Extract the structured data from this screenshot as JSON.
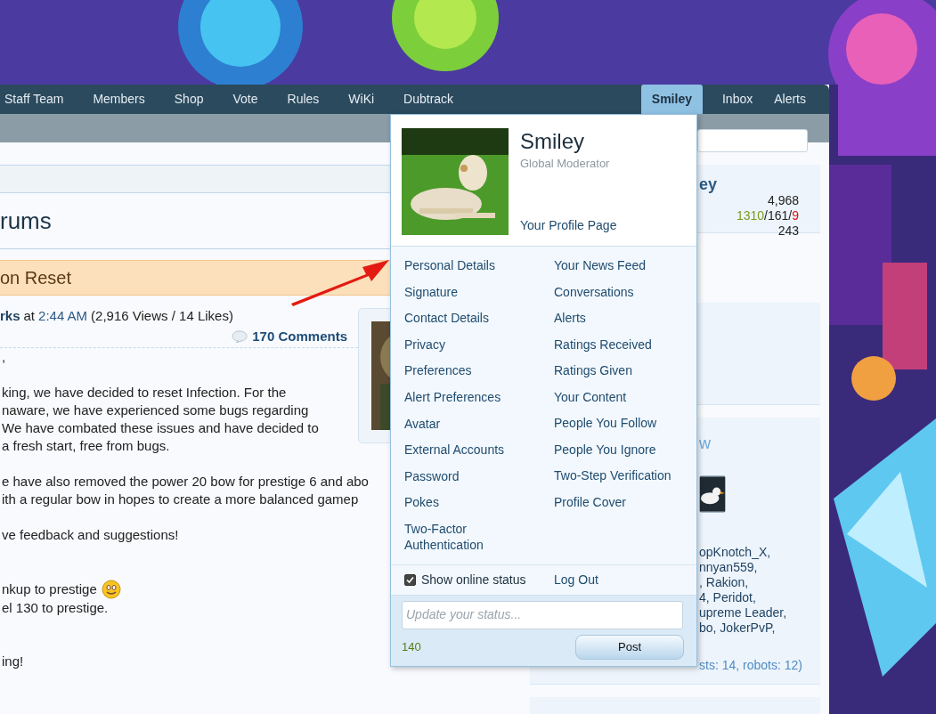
{
  "nav": {
    "tabs": [
      {
        "label": "Staff Team",
        "selected": false
      },
      {
        "label": "Members",
        "selected": false
      },
      {
        "label": "Shop",
        "selected": false
      },
      {
        "label": "Vote",
        "selected": false
      },
      {
        "label": "Rules",
        "selected": false
      },
      {
        "label": "WiKi",
        "selected": false
      },
      {
        "label": "Dubtrack",
        "selected": false
      }
    ],
    "user_tabs": [
      {
        "label": "Smiley",
        "selected": true
      },
      {
        "label": "Inbox",
        "selected": false
      },
      {
        "label": "Alerts",
        "selected": false
      }
    ]
  },
  "page_title": "rums",
  "thread_title": "on Reset",
  "byline": {
    "author": "rks",
    "at": "at",
    "time": "2:44 AM",
    "stats": "(2,916 Views / 14 Likes)"
  },
  "comments": "170 Comments",
  "post_paragraphs": [
    [
      {
        "text": ",",
        "emoji": false
      }
    ],
    [
      {
        "text": "king, we have decided to reset Infection. For the",
        "emoji": false
      },
      {
        "text": "naware, we have experienced some bugs regarding",
        "emoji": false
      },
      {
        "text": "We have combated these issues and have decided to",
        "emoji": false
      },
      {
        "text": "a fresh start, free from bugs.",
        "emoji": false
      }
    ],
    [
      {
        "text": "e have also removed the power 20 bow for prestige 6 and abo",
        "emoji": false
      },
      {
        "text": "ith a regular bow in hopes to create a more balanced gamep",
        "emoji": false
      }
    ],
    [
      {
        "text": "ve feedback and suggestions!",
        "emoji": false
      }
    ],
    [
      {
        "text": "nkup to prestige",
        "emoji": true
      },
      {
        "text": "el 130 to prestige.",
        "emoji": false
      }
    ],
    [
      {
        "text": "ing!",
        "emoji": false
      }
    ]
  ],
  "popup": {
    "name": "Smiley",
    "role": "Global Moderator",
    "profile_link": "Your Profile Page",
    "left_links": [
      "Personal Details",
      "Signature",
      "Contact Details",
      "Privacy",
      "Preferences",
      "Alert Preferences",
      "Avatar",
      "External Accounts",
      "Password",
      "Pokes",
      "Two-Factor Authentication"
    ],
    "right_links": [
      "Your News Feed",
      "Conversations",
      "Alerts",
      "Ratings Received",
      "Ratings Given",
      "Your Content",
      "People You Follow",
      "People You Ignore",
      "Two-Step Verification",
      "Profile Cover"
    ],
    "online_status": {
      "label": "Show online status",
      "checked": true
    },
    "logout": "Log Out",
    "status": {
      "placeholder": "Update your status..."
    },
    "counter": "140",
    "post_button": "Post"
  },
  "sidebar": {
    "name_fragment": "ey",
    "messages": "4,968",
    "ratings_separator": "/",
    "ratings": [
      {
        "text": "1310",
        "color": "#7a9a1e"
      },
      {
        "text": "161",
        "color": "#222222"
      },
      {
        "text": "9",
        "color": "#dd1111"
      }
    ],
    "points": "243",
    "members_heading_fragment": "w",
    "member_lines": [
      "opKnotch_X,",
      "nnyan559,",
      ", Rakion,",
      "4, Peridot,",
      "upreme Leader,",
      "bo, JokerPvP,"
    ],
    "total": "sts: 14, robots: 12)"
  }
}
